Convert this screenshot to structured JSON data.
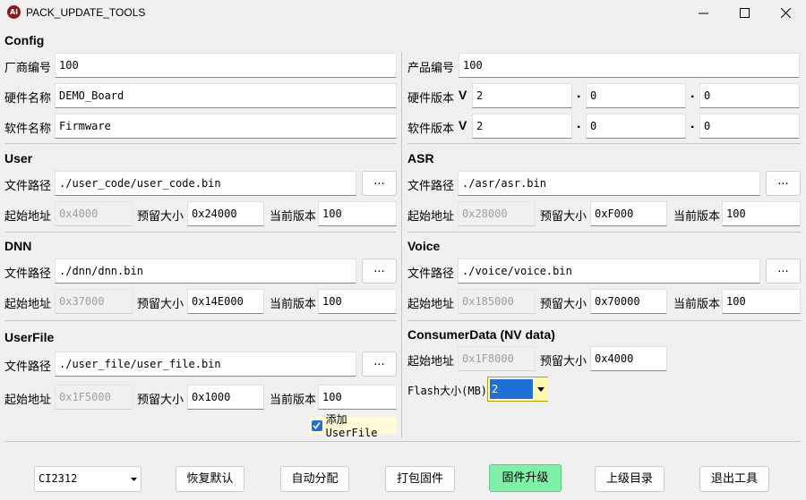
{
  "window": {
    "title": "PACK_UPDATE_TOOLS",
    "icon_text": "Ai"
  },
  "config": {
    "title": "Config",
    "vendor_label": "厂商编号",
    "vendor_value": "100",
    "product_label": "产品编号",
    "product_value": "100",
    "hw_name_label": "硬件名称",
    "hw_name_value": "DEMO_Board",
    "sw_name_label": "软件名称",
    "sw_name_value": "Firmware",
    "hw_ver_label": "硬件版本",
    "sw_ver_label": "软件版本",
    "v": "V",
    "dot": ".",
    "hw_ver": [
      "2",
      "0",
      "0"
    ],
    "sw_ver": [
      "2",
      "0",
      "0"
    ]
  },
  "labels": {
    "path": "文件路径",
    "start": "起始地址",
    "reserve": "预留大小",
    "cur_ver": "当前版本",
    "browse": "..."
  },
  "user": {
    "title": "User",
    "path": "./user_code/user_code.bin",
    "start": "0x4000",
    "reserve": "0x24000",
    "version": "100"
  },
  "asr": {
    "title": "ASR",
    "path": "./asr/asr.bin",
    "start": "0x28000",
    "reserve": "0xF000",
    "version": "100"
  },
  "dnn": {
    "title": "DNN",
    "path": "./dnn/dnn.bin",
    "start": "0x37000",
    "reserve": "0x14E000",
    "version": "100"
  },
  "voice": {
    "title": "Voice",
    "path": "./voice/voice.bin",
    "start": "0x185000",
    "reserve": "0x70000",
    "version": "100"
  },
  "userfile": {
    "title": "UserFile",
    "path": "./user_file/user_file.bin",
    "start": "0x1F5000",
    "reserve": "0x1000",
    "version": "100",
    "add_label": "添加UserFile"
  },
  "consumer": {
    "title": "ConsumerData (NV data)",
    "start": "0x1F8000",
    "reserve": "0x4000",
    "flash_label": "Flash大小(MB)",
    "flash_value": "2"
  },
  "bottom": {
    "chip": "CI2312",
    "restore": "恢复默认",
    "auto": "自动分配",
    "pack": "打包固件",
    "upgrade": "固件升级",
    "parent": "上级目录",
    "exit": "退出工具"
  },
  "colors": {
    "accent": "#1f6fd6",
    "primary_button": "#80f0a8"
  }
}
